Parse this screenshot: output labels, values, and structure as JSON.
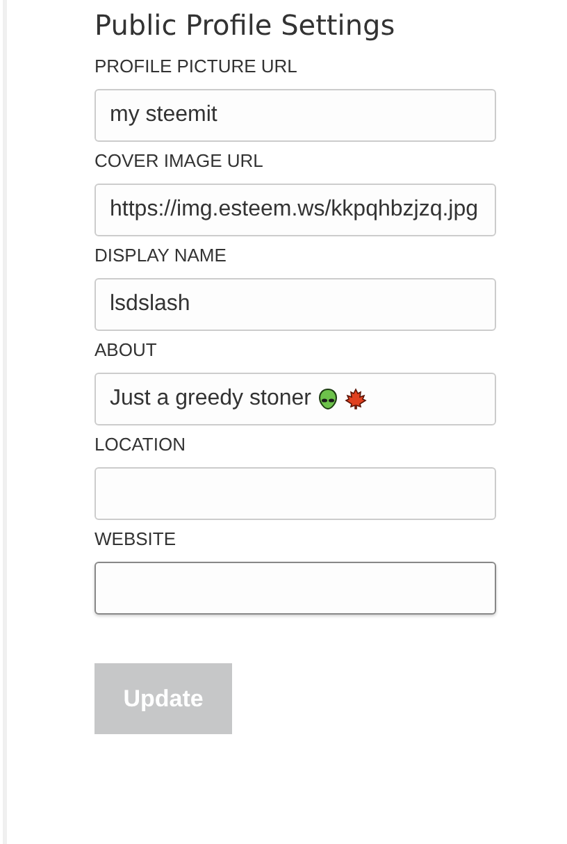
{
  "title": "Public Profile Settings",
  "fields": [
    {
      "label": "PROFILE PICTURE URL",
      "value": "my steemit",
      "kind": "text",
      "focused": false
    },
    {
      "label": "COVER IMAGE URL",
      "value": "https://img.esteem.ws/kkpqhbzjzq.jpg",
      "kind": "text",
      "focused": false
    },
    {
      "label": "DISPLAY NAME",
      "value": "lsdslash",
      "kind": "text",
      "focused": false
    },
    {
      "label": "ABOUT",
      "value": "Just a greedy stoner",
      "kind": "text-with-icons",
      "focused": false
    },
    {
      "label": "LOCATION",
      "kind": "text",
      "focused": false
    },
    {
      "label": "WEBSITE",
      "kind": "text",
      "focused": true
    }
  ],
  "button": {
    "label": "Update",
    "disabled": true
  }
}
